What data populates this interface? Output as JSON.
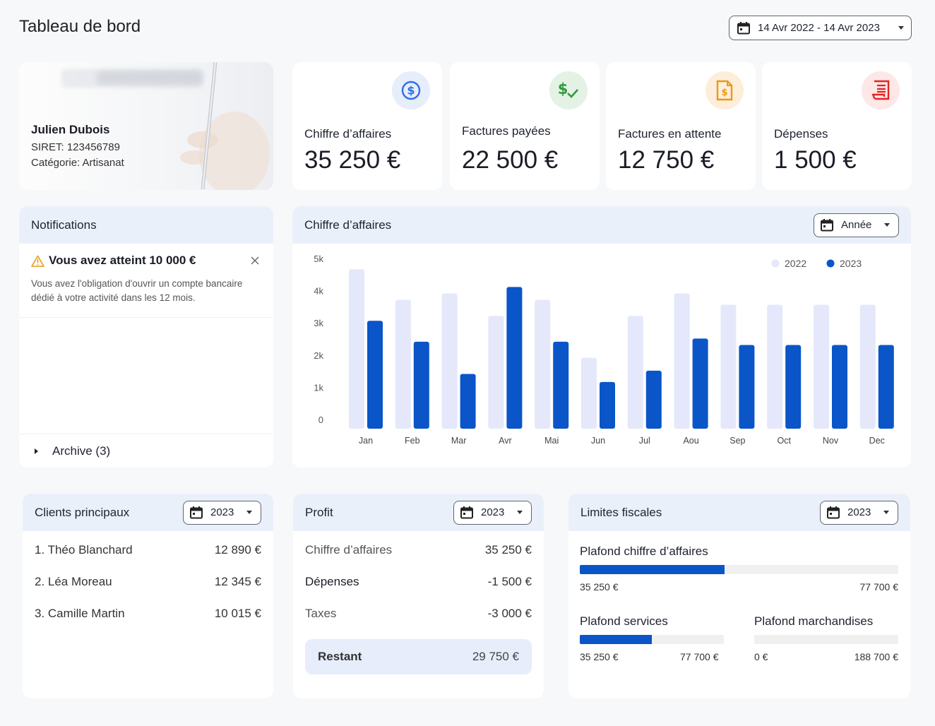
{
  "header": {
    "title": "Tableau de bord",
    "date_range": "14 Avr 2022 - 14 Avr 2023"
  },
  "profile": {
    "name": "Julien Dubois",
    "siret": "SIRET: 123456789",
    "category": "Catégorie: Artisanat"
  },
  "kpis": [
    {
      "label": "Chiffre d’affaires",
      "value": "35 250 €",
      "icon": "dollar-circle-icon",
      "color": "#2f6ee8",
      "bg": "#e6edfb"
    },
    {
      "label": "Factures payées",
      "value": "22 500 €",
      "icon": "dollar-check-icon",
      "color": "#2e9a3a",
      "bg": "#e3f2e5"
    },
    {
      "label": "Factures en attente",
      "value": "12 750 €",
      "icon": "invoice-dollar-icon",
      "color": "#e89a13",
      "bg": "#fdeedb"
    },
    {
      "label": "Dépenses",
      "value": "1 500 €",
      "icon": "receipt-icon",
      "color": "#e22424",
      "bg": "#fde7e7"
    }
  ],
  "notifications": {
    "title": "Notifications",
    "item": {
      "title": "Vous avez atteint 10 000 €",
      "body": "Vous avez l'obligation d'ouvrir un compte bancaire dédié à votre activité dans les 12 mois."
    },
    "archive": "Archive (3)"
  },
  "revenue": {
    "title": "Chiffre d’affaires",
    "period": "Année"
  },
  "chart_data": {
    "type": "bar",
    "categories": [
      "Jan",
      "Feb",
      "Mar",
      "Avr",
      "Mai",
      "Jun",
      "Jul",
      "Aou",
      "Sep",
      "Oct",
      "Nov",
      "Dec"
    ],
    "series": [
      {
        "name": "2022",
        "color": "#e4e8fa",
        "values": [
          4950,
          4000,
          4200,
          3500,
          4000,
          2200,
          3500,
          4200,
          3850,
          3850,
          3850,
          3850
        ]
      },
      {
        "name": "2023",
        "color": "#0a55c8",
        "values": [
          3350,
          2700,
          1700,
          4400,
          2700,
          1450,
          1800,
          2800,
          2600,
          2600,
          2600,
          2600
        ]
      }
    ],
    "yticks": [
      "0",
      "1k",
      "2k",
      "3k",
      "4k",
      "5k"
    ],
    "ylim": [
      0,
      5000
    ],
    "legend_position": "top-right"
  },
  "clients": {
    "title": "Clients principaux",
    "year": "2023",
    "rows": [
      {
        "name": "1. Théo Blanchard",
        "amount": "12 890 €"
      },
      {
        "name": "2. Léa Moreau",
        "amount": "12 345 €"
      },
      {
        "name": "3. Camille Martin",
        "amount": "10 015 €"
      }
    ]
  },
  "profit": {
    "title": "Profit",
    "year": "2023",
    "rows": [
      {
        "label": "Chiffre d’affaires",
        "amount": "35 250 €"
      },
      {
        "label": "Dépenses",
        "amount": "-1 500 €"
      },
      {
        "label": "Taxes",
        "amount": "-3 000 €"
      }
    ],
    "remaining_label": "Restant",
    "remaining_amount": "29 750 €"
  },
  "limits": {
    "title": "Limites fiscales",
    "year": "2023",
    "revenue_cap": {
      "label": "Plafond chiffre d’affaires",
      "current": "35 250 €",
      "max": "77 700 €",
      "progress": 0.454
    },
    "services_cap": {
      "label": "Plafond services",
      "current": "35 250 €",
      "max": "77 700 €",
      "progress": 0.5
    },
    "goods_cap": {
      "label": "Plafond marchandises",
      "current": "0 €",
      "max": "188 700 €",
      "progress": 0
    }
  }
}
